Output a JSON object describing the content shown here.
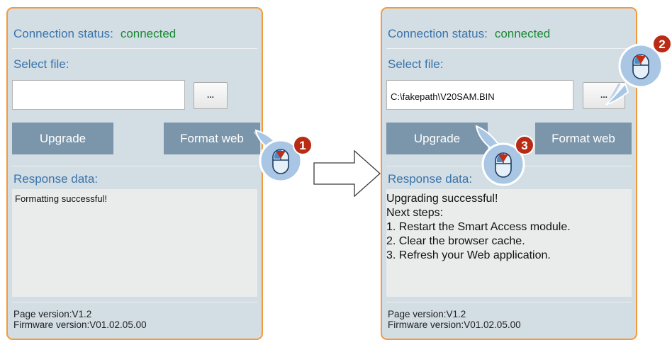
{
  "left_panel": {
    "connection_label": "Connection status:",
    "connection_value": "connected",
    "select_file_label": "Select file:",
    "file_value": "",
    "browse_label": "...",
    "upgrade_label": "Upgrade",
    "format_label": "Format web",
    "response_label": "Response data:",
    "response_lines": [
      "Formatting successful!"
    ],
    "page_version": "Page version:V1.2",
    "firmware_version": "Firmware version:V01.02.05.00"
  },
  "right_panel": {
    "connection_label": "Connection status:",
    "connection_value": "connected",
    "select_file_label": "Select file:",
    "file_value": "C:\\fakepath\\V20SAM.BIN",
    "browse_label": "...",
    "upgrade_label": "Upgrade",
    "format_label": "Format web",
    "response_label": "Response data:",
    "response_lines": [
      "Upgrading successful!",
      "Next steps:",
      "1. Restart the Smart Access module.",
      "2. Clear the browser cache.",
      "3. Refresh your Web application."
    ],
    "page_version": "Page version:V1.2",
    "firmware_version": "Firmware version:V01.02.05.00"
  },
  "step_badges": [
    "1",
    "2",
    "3"
  ],
  "colors": {
    "panel_bg": "#d3dde4",
    "panel_border": "#f39a3c",
    "label_blue": "#3a74aa",
    "connected_green": "#1a8a34",
    "button_bg": "#7b96ab",
    "badge_red": "#b82c16",
    "cursor_blue": "#a9c7e4"
  },
  "icons": [
    "mouse-click-icon",
    "flow-arrow-icon"
  ]
}
